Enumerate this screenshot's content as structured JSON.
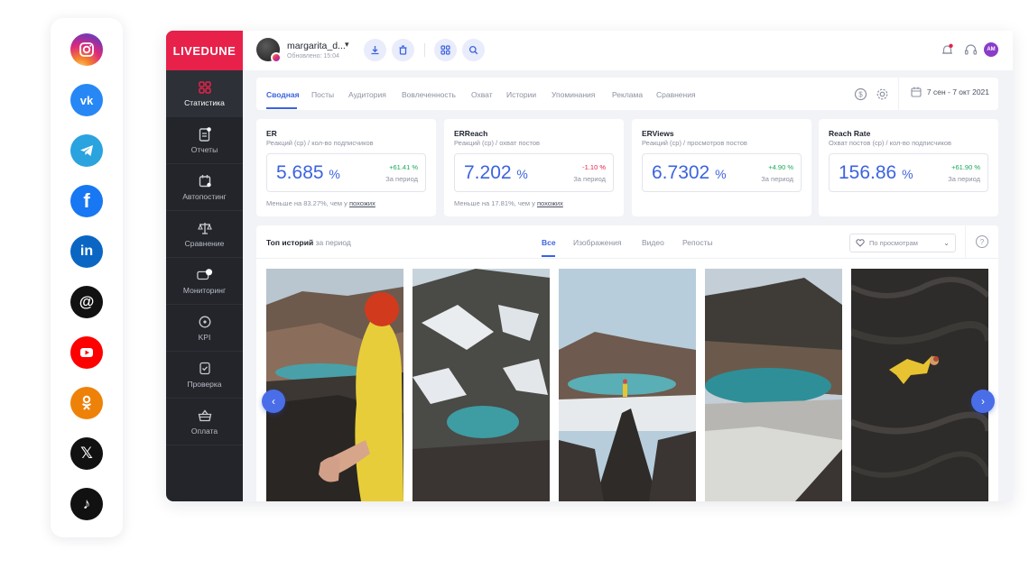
{
  "social_bar": {
    "icons": [
      {
        "name": "instagram-icon",
        "color": "#e1306c"
      },
      {
        "name": "vk-icon",
        "color": "#2787f5"
      },
      {
        "name": "telegram-icon",
        "color": "#2aa3df"
      },
      {
        "name": "facebook-icon",
        "color": "#1877f2"
      },
      {
        "name": "linkedin-icon",
        "color": "#0a66c2"
      },
      {
        "name": "threads-icon",
        "color": "#111111"
      },
      {
        "name": "youtube-icon",
        "color": "#ff0000"
      },
      {
        "name": "odnoklassniki-icon",
        "color": "#ee8208"
      },
      {
        "name": "x-icon",
        "color": "#111111"
      },
      {
        "name": "tiktok-icon",
        "color": "#111111"
      }
    ]
  },
  "app": {
    "logo": "LIVEDUNE",
    "brand_color": "#e7214a",
    "accent_color": "#3c63e0"
  },
  "sidebar": {
    "items": [
      {
        "label": "Статистика",
        "icon": "grid-icon",
        "active": true
      },
      {
        "label": "Отчеты",
        "icon": "report-icon",
        "active": false
      },
      {
        "label": "Автопостинг",
        "icon": "calendar-icon",
        "active": false
      },
      {
        "label": "Сравнение",
        "icon": "scales-icon",
        "active": false
      },
      {
        "label": "Мониторинг",
        "icon": "monitoring-icon",
        "active": false
      },
      {
        "label": "KPI",
        "icon": "target-icon",
        "active": false
      },
      {
        "label": "Проверка",
        "icon": "shield-check-icon",
        "active": false
      },
      {
        "label": "Оплата",
        "icon": "basket-icon",
        "active": false
      }
    ]
  },
  "header": {
    "account_name": "margarita_d...",
    "updated": "Обновлено: 15:04",
    "user_initials": "AM"
  },
  "tabs": {
    "items": [
      "Сводная",
      "Посты",
      "Аудитория",
      "Вовлеченность",
      "Охват",
      "Истории",
      "Упоминания",
      "Реклама",
      "Сравнения"
    ],
    "active": "Сводная",
    "date_range": "7 сен - 7 окт 2021"
  },
  "metrics": [
    {
      "title": "ER",
      "subtitle": "Реакций (ср) / кол-во подписчиков",
      "value": "5.685",
      "unit": "%",
      "delta": "+61.41 %",
      "delta_color": "#18a957",
      "period": "За период",
      "foot_pre": "Меньше на 83.27%, чем у ",
      "foot_link": "похожих"
    },
    {
      "title": "ERReach",
      "subtitle": "Реакций (ср) / охват постов",
      "value": "7.202",
      "unit": "%",
      "delta": "-1.10 %",
      "delta_color": "#e7214a",
      "period": "За период",
      "foot_pre": "Меньше на 17.81%, чем у ",
      "foot_link": "похожих"
    },
    {
      "title": "ERViews",
      "subtitle": "Реакций (ср) / просмотров постов",
      "value": "6.7302",
      "unit": "%",
      "delta": "+4.90 %",
      "delta_color": "#18a957",
      "period": "За период",
      "foot_pre": "",
      "foot_link": ""
    },
    {
      "title": "Reach Rate",
      "subtitle": "Охват постов (ср) / кол-во подписчиков",
      "value": "156.86",
      "unit": "%",
      "delta": "+61.90 %",
      "delta_color": "#18a957",
      "period": "За период",
      "foot_pre": "",
      "foot_link": ""
    }
  ],
  "stories": {
    "title": "Топ историй",
    "title_suffix": "за период",
    "tabs": [
      "Все",
      "Изображения",
      "Видео",
      "Репосты"
    ],
    "active_tab": "Все",
    "sort_label": "По просмотрам",
    "help": "?",
    "prev": "‹",
    "next": "›"
  }
}
